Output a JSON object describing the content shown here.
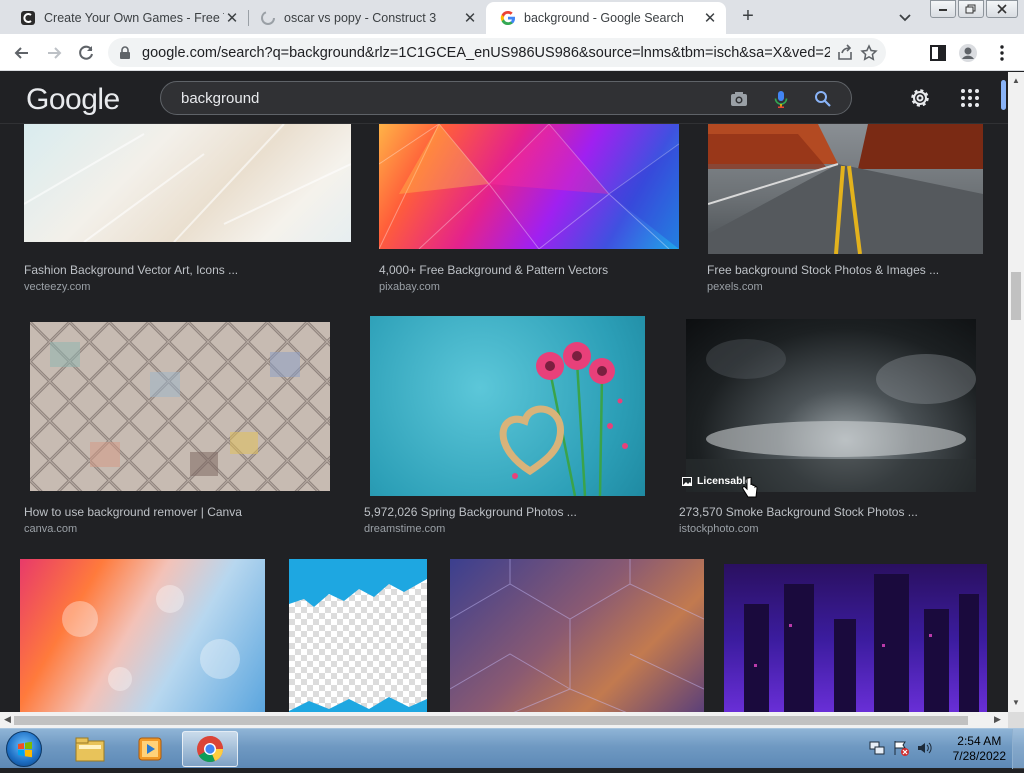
{
  "browser": {
    "tabs": [
      {
        "title": "Create Your Own Games - Free T",
        "close": "✕"
      },
      {
        "title": "oscar vs popy - Construct 3",
        "close": "✕"
      },
      {
        "title": "background - Google Search",
        "close": "✕"
      }
    ],
    "new_tab": "+",
    "url": "google.com/search?q=background&rlz=1C1GCEA_enUS986US986&source=lnms&tbm=isch&sa=X&ved=2ahU..."
  },
  "google": {
    "logo": "Google",
    "query": "background"
  },
  "results": [
    {
      "title": "Fashion Background Vector Art, Icons ...",
      "site": "vecteezy.com"
    },
    {
      "title": "4,000+ Free Background & Pattern Vectors",
      "site": "pixabay.com"
    },
    {
      "title": "Free background Stock Photos & Images ...",
      "site": "pexels.com"
    },
    {
      "title": "How to use background remover | Canva",
      "site": "canva.com"
    },
    {
      "title": "5,972,026 Spring Background Photos ...",
      "site": "dreamstime.com"
    },
    {
      "title": "273,570 Smoke Background Stock Photos ...",
      "site": "istockphoto.com",
      "badge": "Licensable"
    }
  ],
  "taskbar": {
    "time": "2:54 AM",
    "date": "7/28/2022"
  },
  "colors": {
    "page_bg": "#202124",
    "header_bg": "#202124",
    "search_bg": "#303134",
    "title_text": "#bdc1c6",
    "site_text": "#9aa0a6"
  }
}
